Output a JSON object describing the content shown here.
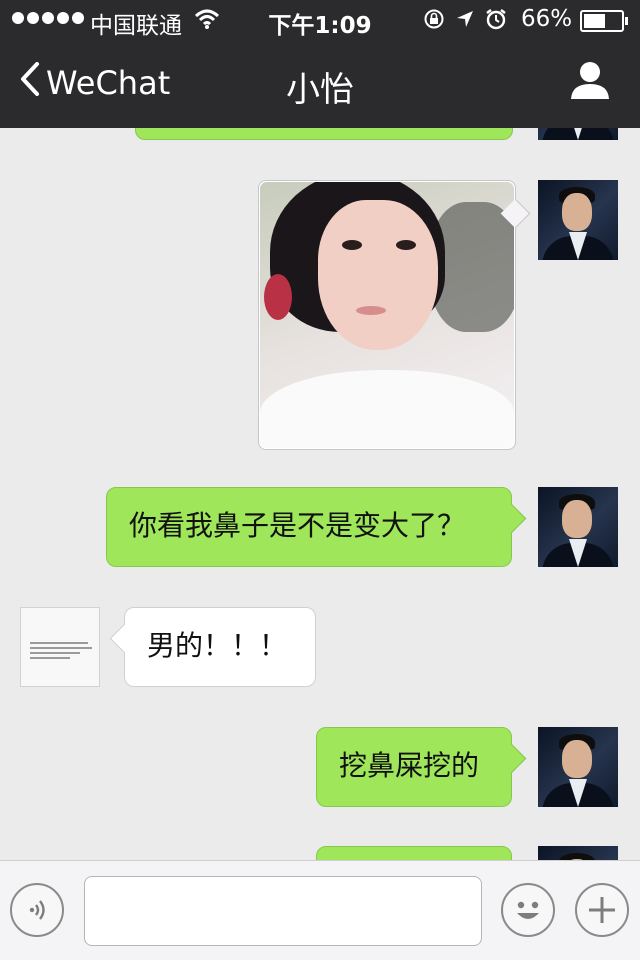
{
  "status_bar": {
    "carrier": "中国联通",
    "time": "下午1:09",
    "battery_percent_text": "66%",
    "battery_level": 0.66
  },
  "nav": {
    "back_label": "WeChat",
    "title": "小怡"
  },
  "messages": [
    {
      "sender": "me",
      "type": "text",
      "text": "",
      "partially_visible": true
    },
    {
      "sender": "me",
      "type": "image"
    },
    {
      "sender": "me",
      "type": "text",
      "text": "你看我鼻子是不是变大了？"
    },
    {
      "sender": "contact",
      "type": "text",
      "text": "男的！！！"
    },
    {
      "sender": "me",
      "type": "text",
      "text": "挖鼻屎挖的"
    },
    {
      "sender": "me",
      "type": "text",
      "text": "",
      "partially_visible": true
    }
  ],
  "input": {
    "value": "",
    "placeholder": ""
  },
  "icons": {
    "signal": "signal-dots-icon",
    "wifi": "wifi-icon",
    "rotation_lock": "rotation-lock-icon",
    "location": "location-arrow-icon",
    "alarm": "alarm-icon",
    "battery": "battery-icon",
    "back": "chevron-left-icon",
    "profile": "person-icon",
    "voice": "voice-icon",
    "emoji": "emoji-icon",
    "more": "plus-icon"
  },
  "colors": {
    "nav_bg": "#2b2b2d",
    "chat_bg": "#ebebeb",
    "bubble_sent": "#9fe65b",
    "bubble_received": "#ffffff"
  }
}
